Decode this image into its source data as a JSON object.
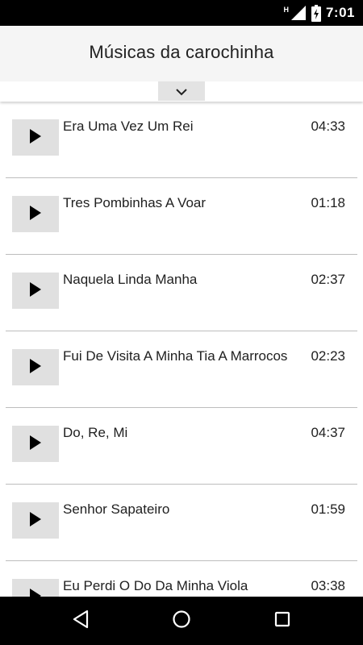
{
  "status_bar": {
    "network_badge": "H",
    "time": "7:01"
  },
  "app_bar": {
    "title": "Músicas da carochinha"
  },
  "songs": [
    {
      "title": "Era Uma Vez Um Rei",
      "duration": "04:33"
    },
    {
      "title": "Tres Pombinhas A Voar",
      "duration": "01:18"
    },
    {
      "title": "Naquela Linda Manha",
      "duration": "02:37"
    },
    {
      "title": "Fui De Visita A Minha Tia A Marrocos",
      "duration": "02:23"
    },
    {
      "title": "Do, Re, Mi",
      "duration": "04:37"
    },
    {
      "title": "Senhor Sapateiro",
      "duration": "01:59"
    },
    {
      "title": "Eu Perdi O Do Da Minha Viola",
      "duration": "03:38"
    }
  ],
  "icons": {
    "expand": "chevron-down-icon",
    "play": "play-icon",
    "back": "back-triangle-icon",
    "home": "home-circle-icon",
    "recents": "recents-square-icon"
  },
  "colors": {
    "status_bar": "#000000",
    "app_bar": "#f5f5f5",
    "play_button": "#e0e0e0",
    "divider": "#bdbdbd",
    "text": "#212121"
  }
}
